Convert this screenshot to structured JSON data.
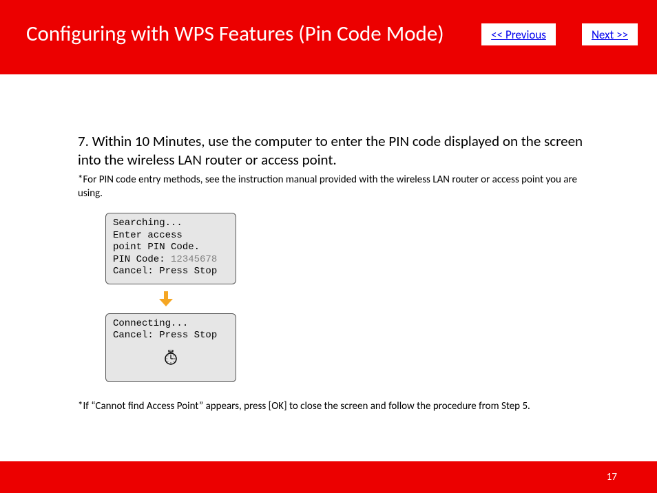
{
  "header": {
    "title": "Configuring with WPS Features (Pin Code Mode)",
    "prev_label": "<< Previous",
    "next_label": "Next >>"
  },
  "main": {
    "step_text": "7. Within 10 Minutes, use the computer to enter the PIN code displayed on the screen into the wireless LAN router or access point.",
    "note1": "*For PIN code entry methods, see the instruction manual provided with the wireless LAN router or access point you are using.",
    "lcd1": {
      "line1": "Searching...",
      "line2": "Enter access",
      "line3": "point PIN Code.",
      "line4_label": "PIN Code: ",
      "line4_value": "12345678",
      "line5": "Cancel: Press Stop"
    },
    "lcd2": {
      "line1": "Connecting...",
      "line2": "Cancel: Press Stop"
    },
    "note2": "*If “Cannot find Access Point” appears, press [OK] to close the screen and follow the procedure from Step 5."
  },
  "footer": {
    "page_number": "17"
  }
}
